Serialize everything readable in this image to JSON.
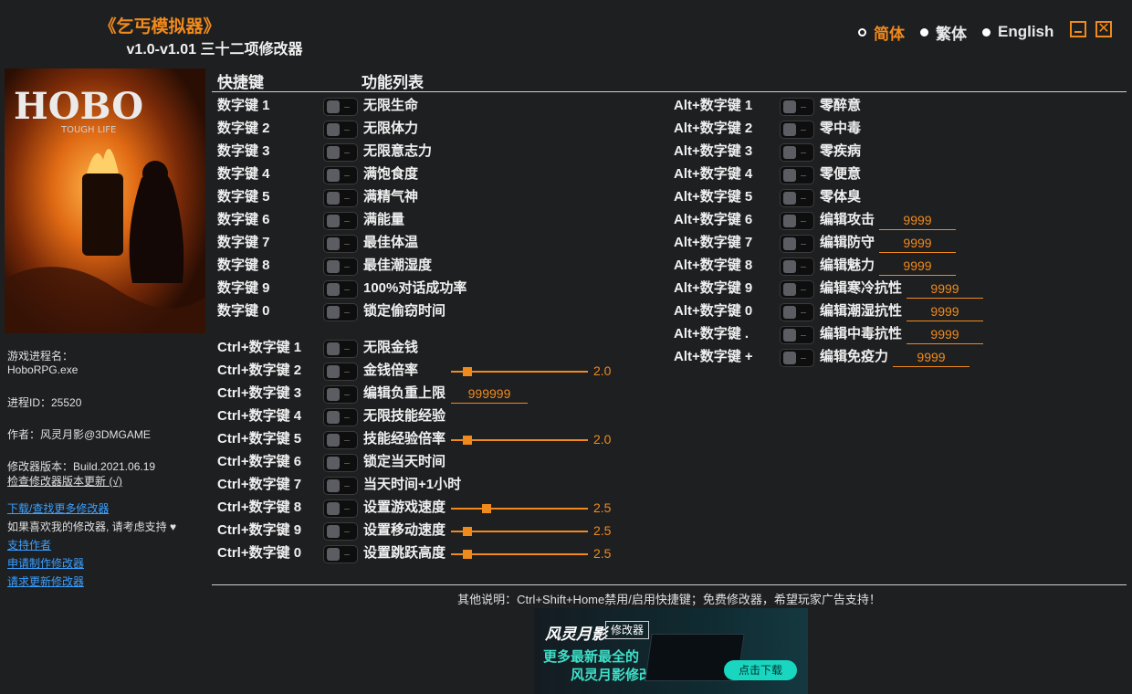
{
  "header": {
    "title": "《乞丐模拟器》",
    "subtitle": "v1.0-v1.01 三十二项修改器"
  },
  "languages": [
    {
      "label": "简体",
      "selected": true
    },
    {
      "label": "繁体",
      "selected": false
    },
    {
      "label": "English",
      "selected": false
    }
  ],
  "window_buttons": {
    "minimize": "minimize-icon",
    "close": "close-icon",
    "close_glyph": "✕"
  },
  "cover": {
    "logo_text": "HOBO",
    "logo_sub": "TOUGH LIFE"
  },
  "sidebar": {
    "process_label": "游戏进程名：",
    "process_name": "HoboRPG.exe",
    "pid": "进程ID：25520",
    "author": "作者：风灵月影@3DMGAME",
    "version": "修改器版本：Build.2021.06.19",
    "check_update": "检查修改器版本更新 (√)",
    "download_more": "下载/查找更多修改器",
    "support_text": "如果喜欢我的修改器, 请考虑支持",
    "support_author": "支持作者",
    "request_trainer": "申请制作修改器",
    "request_update": "请求更新修改器"
  },
  "columns": {
    "hotkey": "快捷键",
    "feature_list": "功能列表"
  },
  "left_group1": [
    {
      "key": "数字键 1",
      "label": "无限生命"
    },
    {
      "key": "数字键 2",
      "label": "无限体力"
    },
    {
      "key": "数字键 3",
      "label": "无限意志力"
    },
    {
      "key": "数字键 4",
      "label": "满饱食度"
    },
    {
      "key": "数字键 5",
      "label": "满精气神"
    },
    {
      "key": "数字键 6",
      "label": "满能量"
    },
    {
      "key": "数字键 7",
      "label": "最佳体温"
    },
    {
      "key": "数字键 8",
      "label": "最佳潮湿度"
    },
    {
      "key": "数字键 9",
      "label": "100%对话成功率"
    },
    {
      "key": "数字键 0",
      "label": "锁定偷窃时间"
    }
  ],
  "left_group2": [
    {
      "key": "Ctrl+数字键 1",
      "label": "无限金钱"
    },
    {
      "key": "Ctrl+数字键 2",
      "label": "金钱倍率",
      "slider": 0.12,
      "value": "2.0"
    },
    {
      "key": "Ctrl+数字键 3",
      "label": "编辑负重上限",
      "field": "999999"
    },
    {
      "key": "Ctrl+数字键 4",
      "label": "无限技能经验"
    },
    {
      "key": "Ctrl+数字键 5",
      "label": "技能经验倍率",
      "slider": 0.12,
      "value": "2.0"
    },
    {
      "key": "Ctrl+数字键 6",
      "label": "锁定当天时间"
    },
    {
      "key": "Ctrl+数字键 7",
      "label": "当天时间+1小时"
    },
    {
      "key": "Ctrl+数字键 8",
      "label": "设置游戏速度",
      "slider": 0.26,
      "value": "2.5"
    },
    {
      "key": "Ctrl+数字键 9",
      "label": "设置移动速度",
      "slider": 0.12,
      "value": "2.5"
    },
    {
      "key": "Ctrl+数字键 0",
      "label": "设置跳跃高度",
      "slider": 0.12,
      "value": "2.5"
    }
  ],
  "right_group": [
    {
      "key": "Alt+数字键 1",
      "label": "零醉意"
    },
    {
      "key": "Alt+数字键 2",
      "label": "零中毒"
    },
    {
      "key": "Alt+数字键 3",
      "label": "零疾病"
    },
    {
      "key": "Alt+数字键 4",
      "label": "零便意"
    },
    {
      "key": "Alt+数字键 5",
      "label": "零体臭"
    },
    {
      "key": "Alt+数字键 6",
      "label": "编辑攻击",
      "field": "9999"
    },
    {
      "key": "Alt+数字键 7",
      "label": "编辑防守",
      "field": "9999"
    },
    {
      "key": "Alt+数字键 8",
      "label": "编辑魅力",
      "field": "9999"
    },
    {
      "key": "Alt+数字键 9",
      "label": "编辑寒冷抗性",
      "field": "9999"
    },
    {
      "key": "Alt+数字键 0",
      "label": "编辑潮湿抗性",
      "field": "9999"
    },
    {
      "key": "Alt+数字键 .",
      "label": "编辑中毒抗性",
      "field": "9999"
    },
    {
      "key": "Alt+数字键 +",
      "label": "编辑免疫力",
      "field": "9999"
    }
  ],
  "footer": {
    "note": "其他说明：Ctrl+Shift+Home禁用/启用快捷键；免费修改器，希望玩家广告支持！"
  },
  "banner": {
    "brand": "风灵月影",
    "tag": "修改器",
    "line1": "更多最新最全的",
    "line2": "风灵月影修改器",
    "button": "点击下载"
  },
  "colors": {
    "accent": "#f08a1c",
    "link": "#3aa0ff",
    "background": "#1e1f21"
  }
}
